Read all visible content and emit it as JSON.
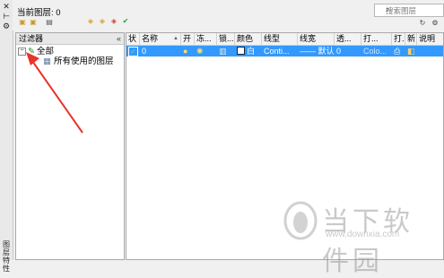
{
  "panel": {
    "current_layer_label": "当前图层: 0",
    "search_placeholder": "搜索图层",
    "side_title": "图层特性"
  },
  "filters": {
    "header": "过滤器",
    "collapse": "«",
    "tree": [
      {
        "label": "全部",
        "expanded": true,
        "level": 0
      },
      {
        "label": "所有使用的图层",
        "level": 1
      }
    ]
  },
  "layer_table": {
    "columns": [
      "状",
      "名称",
      "开",
      "冻...",
      "锁...",
      "颜色",
      "线型",
      "线宽",
      "透...",
      "打...",
      "打.",
      "新",
      "说明"
    ],
    "rows": [
      {
        "status": "✓",
        "name": "0",
        "on": "bulb",
        "freeze": "sun",
        "lock": "unlocked",
        "color": "白",
        "linetype": "Conti...",
        "lineweight": "—— 默认",
        "transparency": "0",
        "plot_style": "Colo...",
        "plot": "printer",
        "new_vp_freeze": "icon",
        "description": ""
      }
    ]
  },
  "colors": {
    "selection": "#3399ff",
    "arrow": "#e8342c"
  },
  "watermark": {
    "text": "当下软件园",
    "url": "www.downxia.com"
  }
}
